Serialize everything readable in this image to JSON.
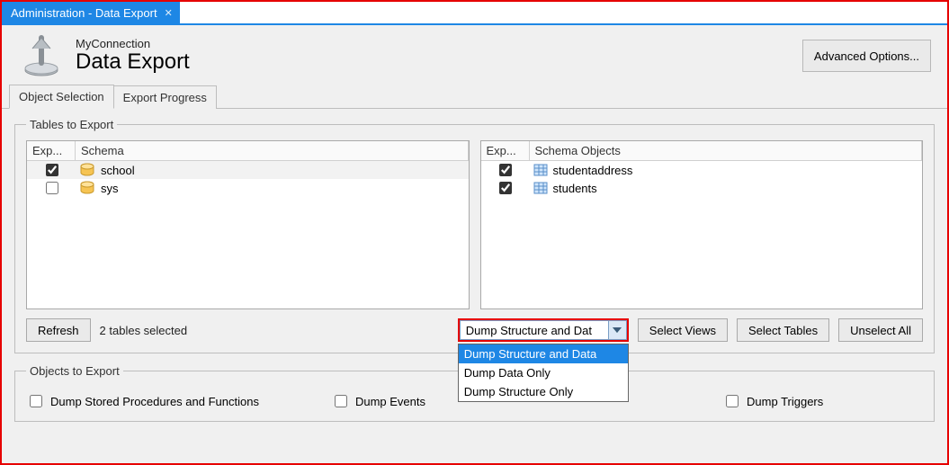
{
  "tab": {
    "title": "Administration - Data Export"
  },
  "header": {
    "connection": "MyConnection",
    "title": "Data Export",
    "advanced_label": "Advanced Options..."
  },
  "subtabs": {
    "t0": "Object Selection",
    "t1": "Export Progress"
  },
  "tables_to_export": {
    "legend": "Tables to Export",
    "left": {
      "col1": "Exp...",
      "col2": "Schema",
      "rows": [
        {
          "checked": true,
          "name": "school"
        },
        {
          "checked": false,
          "name": "sys"
        }
      ]
    },
    "right": {
      "col1": "Exp...",
      "col2": "Schema Objects",
      "rows": [
        {
          "checked": true,
          "name": "studentaddress"
        },
        {
          "checked": true,
          "name": "students"
        }
      ]
    },
    "refresh_label": "Refresh",
    "status": "2 tables selected",
    "dropdown": {
      "visible": "Dump Structure and Dat",
      "options": [
        "Dump Structure and Data",
        "Dump Data Only",
        "Dump Structure Only"
      ],
      "selected_index": 0
    },
    "btn_select_views": "Select Views",
    "btn_select_tables": "Select Tables",
    "btn_unselect_all": "Unselect All"
  },
  "objects_to_export": {
    "legend": "Objects to Export",
    "stored_procs": "Dump Stored Procedures and Functions",
    "events": "Dump Events",
    "triggers": "Dump Triggers"
  }
}
